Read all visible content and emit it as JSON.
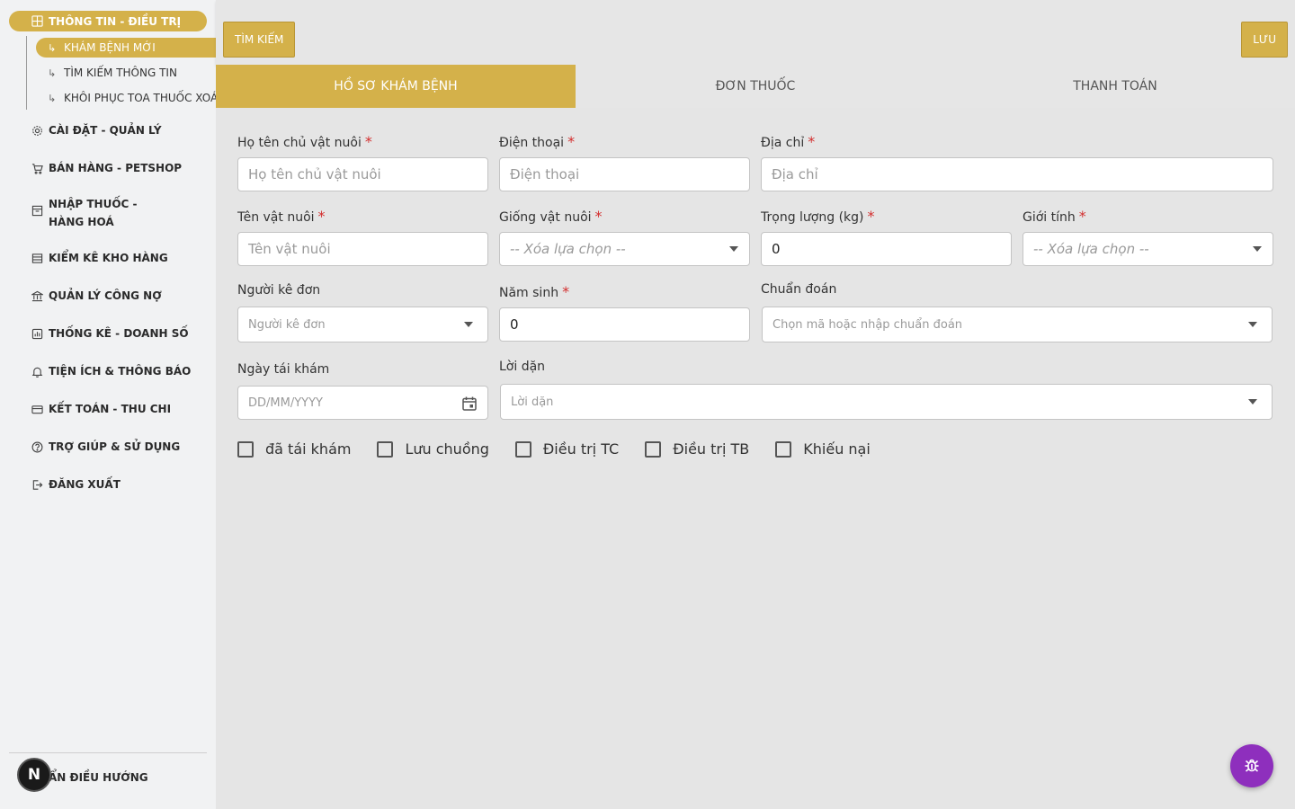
{
  "sidebar": {
    "sections": [
      {
        "label": "THÔNG TIN - ĐIỀU TRỊ",
        "icon": "grid-icon"
      },
      {
        "label": "CÀI ĐẶT - QUẢN LÝ",
        "icon": "gear-icon"
      },
      {
        "label": "BÁN HÀNG - PETSHOP",
        "icon": "cart-icon"
      },
      {
        "label": "NHẬP THUỐC - HÀNG HOÁ",
        "icon": "archive-icon"
      },
      {
        "label": "KIỂM KÊ KHO HÀNG",
        "icon": "list-icon"
      },
      {
        "label": "QUẢN LÝ CÔNG NỢ",
        "icon": "bank-icon"
      },
      {
        "label": "THỐNG KÊ - DOANH SỐ",
        "icon": "chart-icon"
      },
      {
        "label": "TIỆN ÍCH & THÔNG BÁO",
        "icon": "bell-icon"
      },
      {
        "label": "KẾT TOÁN - THU CHI",
        "icon": "card-icon"
      },
      {
        "label": "TRỢ GIÚP & SỬ DỤNG",
        "icon": "help-icon"
      },
      {
        "label": "ĐĂNG XUẤT",
        "icon": "logout-icon"
      }
    ],
    "sub_items": [
      {
        "label": "KHÁM BỆNH MỚI"
      },
      {
        "label": "TÌM KIẾM THÔNG TIN"
      },
      {
        "label": "KHÔI PHỤC TOA THUỐC XOÁ"
      }
    ],
    "collapse_label": "ẨN ĐIỀU HƯỚNG",
    "badge_letter": "N"
  },
  "toolbar": {
    "search_label": "TÌM KIẾM",
    "save_label": "LƯU"
  },
  "tabs": [
    {
      "label": "HỒ SƠ KHÁM BỆNH"
    },
    {
      "label": "ĐƠN THUỐC"
    },
    {
      "label": "THANH TOÁN"
    }
  ],
  "form": {
    "owner": {
      "label": "Họ tên chủ vật nuôi",
      "placeholder": "Họ tên chủ vật nuôi"
    },
    "phone": {
      "label": "Điện thoại",
      "placeholder": "Điện thoại"
    },
    "address": {
      "label": "Địa chỉ",
      "placeholder": "Địa chỉ"
    },
    "pet_name": {
      "label": "Tên vật nuôi",
      "placeholder": "Tên vật nuôi"
    },
    "breed": {
      "label": "Giống vật nuôi",
      "placeholder": "-- Xóa lựa chọn --"
    },
    "weight": {
      "label": "Trọng lượng (kg)",
      "value": "0"
    },
    "gender": {
      "label": "Giới tính",
      "placeholder": "-- Xóa lựa chọn --"
    },
    "prescriber": {
      "label": "Người kê đơn",
      "placeholder": "Người kê đơn"
    },
    "birth_year": {
      "label": "Năm sinh",
      "value": "0"
    },
    "diagnosis": {
      "label": "Chuẩn đoán",
      "placeholder": "Chọn mã hoặc nhập chuẩn đoán"
    },
    "revisit_date": {
      "label": "Ngày tái khám",
      "placeholder": "DD/MM/YYYY"
    },
    "advice": {
      "label": "Lời dặn",
      "placeholder": "Lời dặn"
    },
    "required_mark": "*"
  },
  "checkboxes": [
    {
      "label": "đã tái khám"
    },
    {
      "label": "Lưu chuồng"
    },
    {
      "label": "Điều trị TC"
    },
    {
      "label": "Điều trị TB"
    },
    {
      "label": "Khiếu nại"
    }
  ],
  "colors": {
    "accent": "#d4b14a",
    "required": "#d32f2f",
    "bug_button": "#8e2fbd"
  }
}
